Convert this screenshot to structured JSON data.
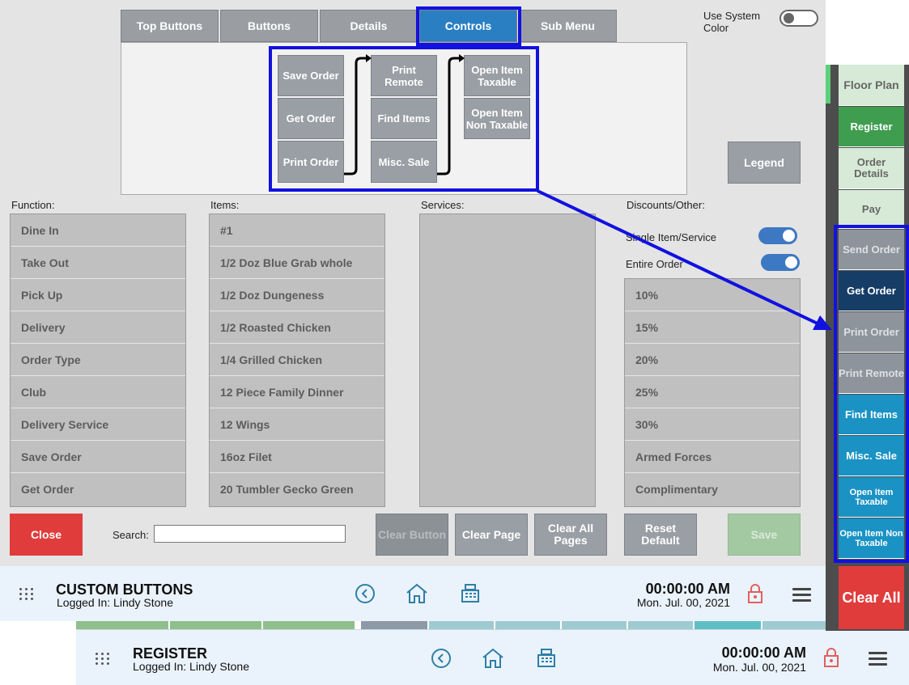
{
  "background_screen": {
    "title": "REGISTER",
    "logged_in": "Logged In:  Lindy Stone",
    "time": "00:00:00 AM",
    "date": "Mon. Jul. 00, 2021"
  },
  "side_nav": {
    "items": [
      {
        "label": "Floor Plan"
      },
      {
        "label": "Register"
      },
      {
        "label": "Order Details"
      },
      {
        "label": "Pay"
      },
      {
        "label": "Send Order"
      },
      {
        "label": "Get Order"
      },
      {
        "label": "Print Order"
      },
      {
        "label": "Print Remote"
      },
      {
        "label": "Find Items"
      },
      {
        "label": "Misc. Sale"
      },
      {
        "label": "Open Item Taxable"
      },
      {
        "label": "Open Item Non Taxable"
      }
    ],
    "clear_all": "Clear All"
  },
  "tabs": [
    {
      "label": "Top Buttons"
    },
    {
      "label": "Buttons"
    },
    {
      "label": "Details"
    },
    {
      "label": "Controls",
      "active": true
    },
    {
      "label": "Sub Menu"
    }
  ],
  "system_color_label": "Use System Color",
  "preview": {
    "col1": [
      "Save Order",
      "Get Order",
      "Print Order"
    ],
    "col2": [
      "Print Remote",
      "Find Items",
      "Misc. Sale"
    ],
    "col3": [
      "Open Item Taxable",
      "Open Item Non Taxable"
    ]
  },
  "legend_label": "Legend",
  "function": {
    "label": "Function:",
    "items": [
      "Dine In",
      "Take Out",
      "Pick Up",
      "Delivery",
      "Order Type",
      "Club",
      "Delivery Service",
      "Save Order",
      "Get Order"
    ]
  },
  "items": {
    "label": "Items:",
    "items": [
      "#1",
      "1/2 Doz Blue Grab whole",
      "1/2 Doz Dungeness",
      "1/2 Roasted Chicken",
      "1/4 Grilled Chicken",
      "12 Piece Family Dinner",
      "12 Wings",
      "16oz Filet",
      "20 Tumbler Gecko Green"
    ]
  },
  "services": {
    "label": "Services:"
  },
  "discounts": {
    "label": "Discounts/Other:",
    "single_item": "Single Item/Service",
    "entire_order": "Entire Order",
    "items": [
      "10%",
      "15%",
      "20%",
      "25%",
      "30%",
      "Armed Forces",
      "Complimentary"
    ]
  },
  "actions": {
    "close": "Close",
    "search_label": "Search:",
    "search_value": "",
    "clear_button": "Clear Button",
    "clear_page": "Clear Page",
    "clear_all_pages": "Clear All Pages",
    "reset_default": "Reset Default",
    "save": "Save"
  },
  "footer": {
    "title": "CUSTOM BUTTONS",
    "logged_in": "Logged In:  Lindy Stone",
    "time": "00:00:00 AM",
    "date": "Mon. Jul. 00, 2021"
  },
  "colors": {
    "accent": "#2a7fc3",
    "highlight": "#1111e0",
    "close": "#e03c3c",
    "clear_all": "#e03c3c",
    "register_green": "#3f9d4f"
  }
}
